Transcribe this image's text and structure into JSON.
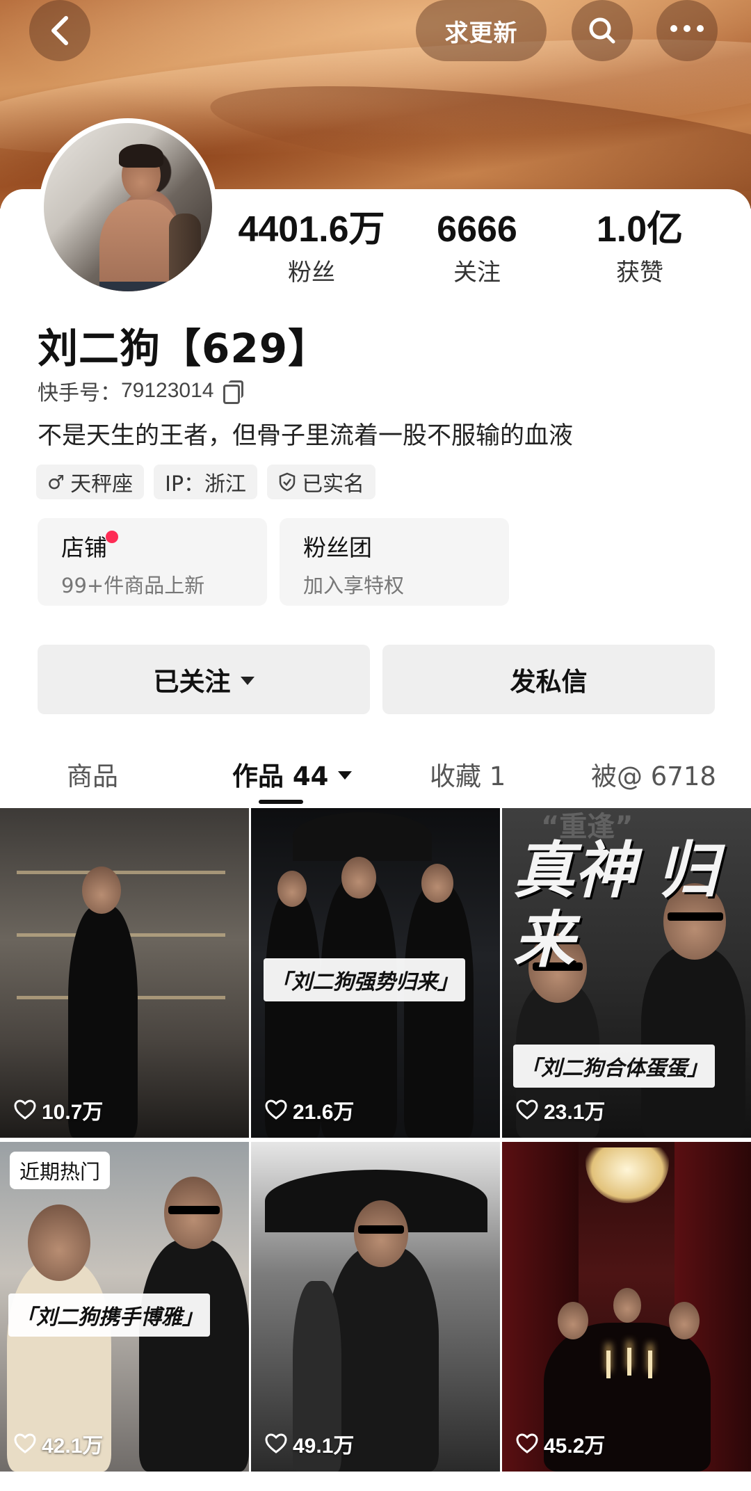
{
  "header": {
    "update_label": "求更新"
  },
  "profile": {
    "name": "刘二狗【629】",
    "uid_label": "快手号：",
    "uid": "79123014",
    "bio": "不是天生的王者，但骨子里流着一股不服输的血液",
    "stats": [
      {
        "value": "4401.6万",
        "label": "粉丝"
      },
      {
        "value": "6666",
        "label": "关注"
      },
      {
        "value": "1.0亿",
        "label": "获赞"
      }
    ],
    "tags": [
      {
        "icon": "male-icon",
        "text": "天秤座"
      },
      {
        "icon": "",
        "text": "IP：浙江"
      },
      {
        "icon": "verified-shield-icon",
        "text": "已实名"
      }
    ]
  },
  "entries": {
    "shop": {
      "title": "店铺",
      "subtitle": "99+件商品上新"
    },
    "fan_club": {
      "title": "粉丝团",
      "subtitle": "加入享特权"
    }
  },
  "actions": {
    "followed": "已关注",
    "message": "发私信"
  },
  "tabs": [
    {
      "label": "商品"
    },
    {
      "label": "作品 44",
      "active": true
    },
    {
      "label": "收藏 1"
    },
    {
      "label": "被@ 6718"
    }
  ],
  "videos": [
    {
      "likes": "10.7万"
    },
    {
      "likes": "21.6万",
      "caption": "「刘二狗强势归来」"
    },
    {
      "likes": "23.1万",
      "caption": "「刘二狗合体蛋蛋」",
      "overlay_top": "“重逢”",
      "overlay_main": "真神 归来"
    },
    {
      "likes": "42.1万",
      "caption": "「刘二狗携手博雅」",
      "badge": "近期热门"
    },
    {
      "likes": "49.1万"
    },
    {
      "likes": "45.2万"
    }
  ],
  "colors": {
    "accent_red": "#fe2c55",
    "card_bg": "#f5f5f5"
  }
}
